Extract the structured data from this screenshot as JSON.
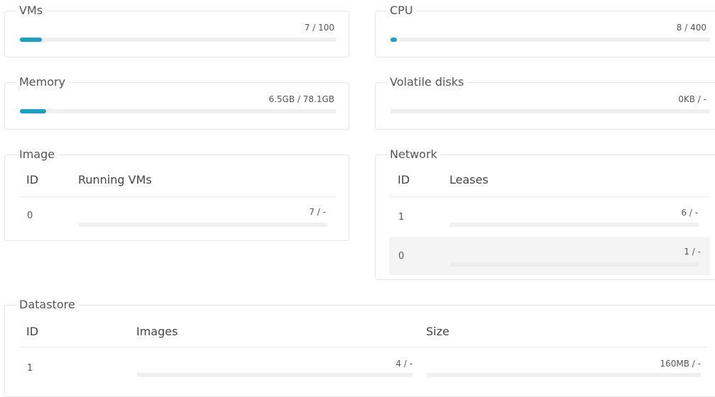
{
  "quotas": {
    "vms": {
      "title": "VMs",
      "value_text": "7 / 100",
      "fraction": 0.07
    },
    "cpu": {
      "title": "CPU",
      "value_text": "8 / 400",
      "fraction": 0.02
    },
    "memory": {
      "title": "Memory",
      "value_text": "6.5GB / 78.1GB",
      "fraction": 0.083
    },
    "volatile": {
      "title": "Volatile disks",
      "value_text": "0KB / -",
      "fraction": 0
    }
  },
  "image": {
    "title": "Image",
    "columns": [
      "ID",
      "Running VMs"
    ],
    "rows": [
      {
        "id": "0",
        "value_text": "7 / -"
      }
    ]
  },
  "network": {
    "title": "Network",
    "columns": [
      "ID",
      "Leases"
    ],
    "rows": [
      {
        "id": "1",
        "value_text": "6 / -"
      },
      {
        "id": "0",
        "value_text": "1 / -"
      }
    ]
  },
  "datastore": {
    "title": "Datastore",
    "columns": [
      "ID",
      "Images",
      "Size"
    ],
    "rows": [
      {
        "id": "1",
        "images_text": "4 / -",
        "size_text": "160MB / -"
      }
    ]
  },
  "colors": {
    "accent": "#16a2c7",
    "track": "#f0f0f0",
    "border": "#e6e6e6"
  }
}
